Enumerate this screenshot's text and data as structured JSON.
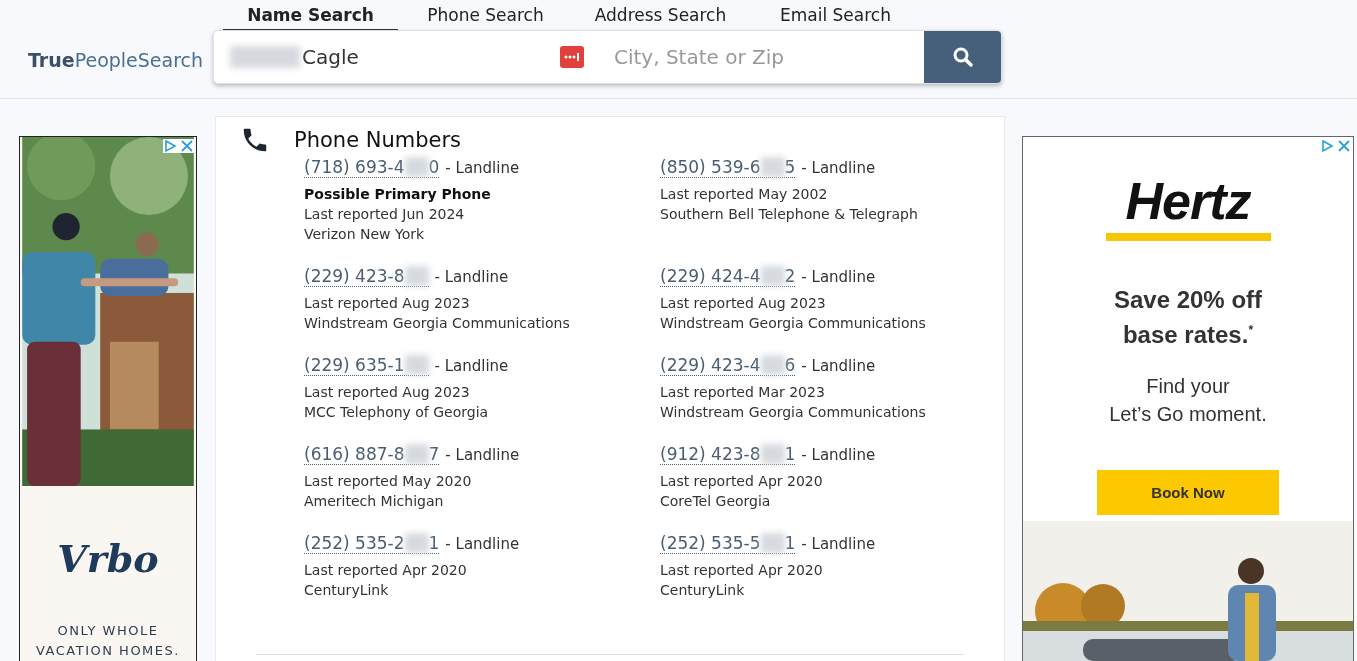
{
  "logo": "**True**PeopleSearch",
  "tabs": [
    {
      "label": "Name Search",
      "selected": true
    },
    {
      "label": "Phone Search",
      "selected": false
    },
    {
      "label": "Address Search",
      "selected": false
    },
    {
      "label": "Email Search",
      "selected": false
    }
  ],
  "search": {
    "name_value": "Cagle",
    "name_blurred": true,
    "location_placeholder": "City, State or Zip"
  },
  "section": {
    "title": "Phone Numbers"
  },
  "phones": [
    {
      "head": "(718) 693-4",
      "tail": "0",
      "type": "- Landline",
      "primary": "Possible Primary Phone",
      "reported": "Last reported Jun 2024",
      "carrier": "Verizon New York"
    },
    {
      "head": "(850) 539-6",
      "tail": "5",
      "type": "- Landline",
      "reported": "Last reported May 2002",
      "carrier": "Southern Bell Telephone & Telegraph"
    },
    {
      "head": "(229) 423-8",
      "type": "- Landline",
      "reported": "Last reported Aug 2023",
      "carrier": "Windstream Georgia Communications"
    },
    {
      "head": "(229) 424-4",
      "tail": "2",
      "type": "- Landline",
      "reported": "Last reported Aug 2023",
      "carrier": "Windstream Georgia Communications"
    },
    {
      "head": "(229) 635-1",
      "type": "- Landline",
      "reported": "Last reported Aug 2023",
      "carrier": "MCC Telephony of Georgia"
    },
    {
      "head": "(229) 423-4",
      "tail": "6",
      "type": "- Landline",
      "reported": "Last reported Mar 2023",
      "carrier": "Windstream Georgia Communications"
    },
    {
      "head": "(616) 887-8",
      "tail": "7",
      "type": "- Landline",
      "reported": "Last reported May 2020",
      "carrier": "Ameritech Michigan"
    },
    {
      "head": "(912) 423-8",
      "tail": "1",
      "type": "- Landline",
      "reported": "Last reported Apr 2020",
      "carrier": "CoreTel Georgia"
    },
    {
      "head": "(252) 535-2",
      "tail": "1",
      "type": "- Landline",
      "reported": "Last reported Apr 2020",
      "carrier": "CenturyLink"
    },
    {
      "head": "(252) 535-5",
      "tail": "1",
      "type": "- Landline",
      "reported": "Last reported Apr 2020",
      "carrier": "CenturyLink"
    }
  ],
  "left_ad": {
    "brand": "Vrbo",
    "tagline": "ONLY WHOLE VACATION HOMES."
  },
  "right_ad": {
    "brand": "Hertz",
    "headline": "Save 20% off base rates.$^{*}$",
    "subline": "Find your\nLet’s Go moment.",
    "button": "Book Now"
  }
}
